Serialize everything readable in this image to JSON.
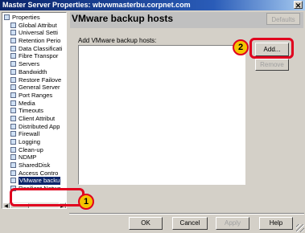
{
  "window": {
    "title": "Master Server Properties: wbvwmasterbu.corpnet.com",
    "close_glyph": "✕"
  },
  "tree": {
    "items": [
      {
        "label": "Properties",
        "level": 0
      },
      {
        "label": "Global Attribut",
        "level": 1
      },
      {
        "label": "Universal Setti",
        "level": 1
      },
      {
        "label": "Retention Perio",
        "level": 1
      },
      {
        "label": "Data Classificati",
        "level": 1
      },
      {
        "label": "Fibre Transpor",
        "level": 1
      },
      {
        "label": "Servers",
        "level": 1
      },
      {
        "label": "Bandwidth",
        "level": 1
      },
      {
        "label": "Restore Failove",
        "level": 1
      },
      {
        "label": "General Server",
        "level": 1
      },
      {
        "label": "Port Ranges",
        "level": 1
      },
      {
        "label": "Media",
        "level": 1
      },
      {
        "label": "Timeouts",
        "level": 1
      },
      {
        "label": "Client Attribut",
        "level": 1
      },
      {
        "label": "Distributed App",
        "level": 1
      },
      {
        "label": "Firewall",
        "level": 1
      },
      {
        "label": "Logging",
        "level": 1
      },
      {
        "label": "Clean-up",
        "level": 1
      },
      {
        "label": "NDMP",
        "level": 1
      },
      {
        "label": "SharedDisk",
        "level": 1
      },
      {
        "label": "Access Contro",
        "level": 1
      },
      {
        "label": "VMware backu",
        "level": 1,
        "selected": true
      },
      {
        "label": "Resilient Netwo",
        "level": 1
      }
    ]
  },
  "page": {
    "title": "VMware backup hosts",
    "defaults_label": "Defaults",
    "list_label": "Add VMware backup hosts:"
  },
  "buttons": {
    "add": "Add...",
    "remove": "Remove",
    "ok": "OK",
    "cancel": "Cancel",
    "apply": "Apply",
    "help": "Help"
  },
  "annotations": {
    "step1": "1",
    "step2": "2",
    "color_highlight": "#e0001e",
    "color_callout": "#f4c400"
  }
}
